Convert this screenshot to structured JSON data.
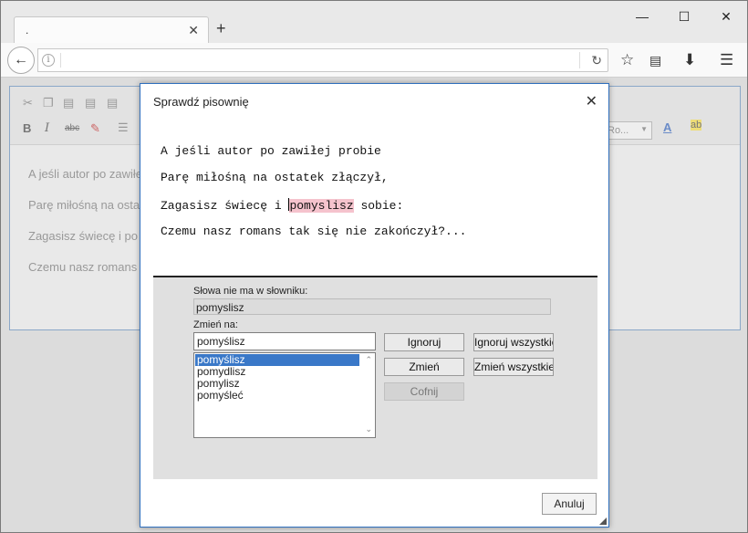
{
  "browser": {
    "tab_title": ".",
    "tab_close": "✕",
    "new_tab": "+",
    "url": "",
    "win_min": "—",
    "win_max": "☐",
    "win_close": "✕"
  },
  "editor_bg_lines": [
    "A jeśli autor po zawiłej",
    "Parę miłośną na ostat",
    "Zagasisz świecę i po",
    "Czemu nasz romans"
  ],
  "editor_font_select": "Ro...",
  "dialog": {
    "title": "Sprawdź pisownię",
    "close": "✕",
    "preview_lines": [
      "A jeśli autor po zawiłej probie",
      "Parę miłośną na ostatek złączył,",
      "Czemu nasz romans tak się nie zakończył?..."
    ],
    "line3_before": "Zagasisz świecę i ",
    "line3_word": "pomyslisz",
    "line3_after": " sobie:",
    "not_in_dict_label": "Słowa nie ma w słowniku:",
    "not_in_dict_value": "pomyslisz",
    "change_to_label": "Zmień na:",
    "change_to_value": "pomyślisz",
    "suggestions": [
      "pomyślisz",
      "pomydlisz",
      "pomylisz",
      "pomyśleć"
    ],
    "selected_suggestion": 0,
    "buttons": {
      "ignore": "Ignoruj",
      "ignore_all": "Ignoruj wszystkie",
      "change": "Zmień",
      "change_all": "Zmień wszystkie",
      "undo": "Cofnij",
      "cancel": "Anuluj"
    }
  },
  "icons": {
    "back": "back-arrow-icon",
    "info": "info-icon",
    "reload": "reload-icon",
    "bookmark": "star-icon",
    "reader": "reading-list-icon",
    "download": "download-icon",
    "menu": "hamburger-menu-icon"
  }
}
